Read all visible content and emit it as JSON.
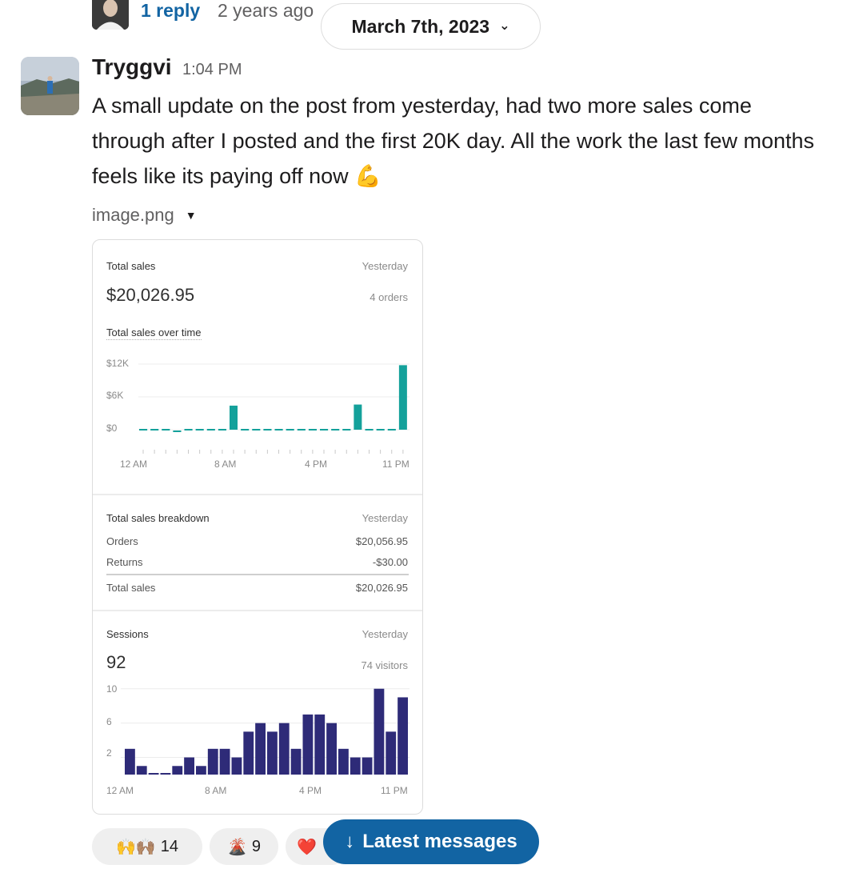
{
  "thread": {
    "reply_link": "1 reply",
    "reply_time": "2 years ago"
  },
  "date_divider": {
    "label": "March 7th, 2023",
    "icon": "chevron-down-icon"
  },
  "message": {
    "author": "Tryggvi",
    "time": "1:04 PM",
    "text": "A small update on the post from yesterday, had two more sales come through after I posted and the first 20K day. All the work the last few months feels like its paying off now",
    "emoji": "💪",
    "attachment": {
      "filename": "image.png",
      "icon": "caret-down-icon"
    }
  },
  "card": {
    "sales": {
      "title": "Total sales",
      "period": "Yesterday",
      "amount": "$20,026.95",
      "orders": "4 orders",
      "chart_title": "Total sales over time",
      "y_ticks": [
        "$12K",
        "$6K",
        "$0"
      ],
      "x_ticks": [
        "12 AM",
        "8 AM",
        "4 PM",
        "11 PM"
      ]
    },
    "breakdown": {
      "title": "Total sales breakdown",
      "period": "Yesterday",
      "rows": [
        {
          "label": "Orders",
          "value": "$20,056.95"
        },
        {
          "label": "Returns",
          "value": "-$30.00"
        }
      ],
      "total": {
        "label": "Total sales",
        "value": "$20,026.95"
      }
    },
    "sessions": {
      "title": "Sessions",
      "period": "Yesterday",
      "count": "92",
      "visitors": "74 visitors",
      "y_ticks": [
        "10",
        "6",
        "2"
      ],
      "x_ticks": [
        "12 AM",
        "8 AM",
        "4 PM",
        "11 PM"
      ]
    },
    "colors": {
      "sales_bar": "#14a19b",
      "sessions_bar": "#2e2b78"
    }
  },
  "chart_data": [
    {
      "type": "bar",
      "title": "Total sales over time",
      "x": [
        "12 AM",
        "1 AM",
        "2 AM",
        "3 AM",
        "4 AM",
        "5 AM",
        "6 AM",
        "7 AM",
        "8 AM",
        "9 AM",
        "10 AM",
        "11 AM",
        "12 PM",
        "1 PM",
        "2 PM",
        "3 PM",
        "4 PM",
        "5 PM",
        "6 PM",
        "7 PM",
        "8 PM",
        "9 PM",
        "10 PM",
        "11 PM"
      ],
      "values": [
        0,
        0,
        0,
        -200,
        0,
        0,
        0,
        0,
        4400,
        0,
        0,
        0,
        0,
        0,
        0,
        0,
        0,
        0,
        0,
        4600,
        0,
        0,
        0,
        11800
      ],
      "ylim": [
        0,
        12000
      ],
      "grid": true
    },
    {
      "type": "bar",
      "title": "Sessions",
      "x": [
        "12 AM",
        "1 AM",
        "2 AM",
        "3 AM",
        "4 AM",
        "5 AM",
        "6 AM",
        "7 AM",
        "8 AM",
        "9 AM",
        "10 AM",
        "11 AM",
        "12 PM",
        "1 PM",
        "2 PM",
        "3 PM",
        "4 PM",
        "5 PM",
        "6 PM",
        "7 PM",
        "8 PM",
        "9 PM",
        "10 PM",
        "11 PM"
      ],
      "values": [
        3,
        1,
        0,
        0,
        1,
        2,
        1,
        3,
        3,
        2,
        5,
        6,
        5,
        6,
        3,
        7,
        7,
        6,
        3,
        2,
        2,
        10,
        5,
        9
      ],
      "ylim": [
        0,
        11
      ],
      "grid": true
    }
  ],
  "reactions": [
    {
      "emoji": "🙌🙌🏽",
      "count": "14"
    },
    {
      "emoji": "🌋",
      "count": "9"
    },
    {
      "emoji": "❤️",
      "count": ""
    }
  ],
  "latest_button": {
    "label": "Latest messages",
    "icon": "arrow-down-icon"
  }
}
